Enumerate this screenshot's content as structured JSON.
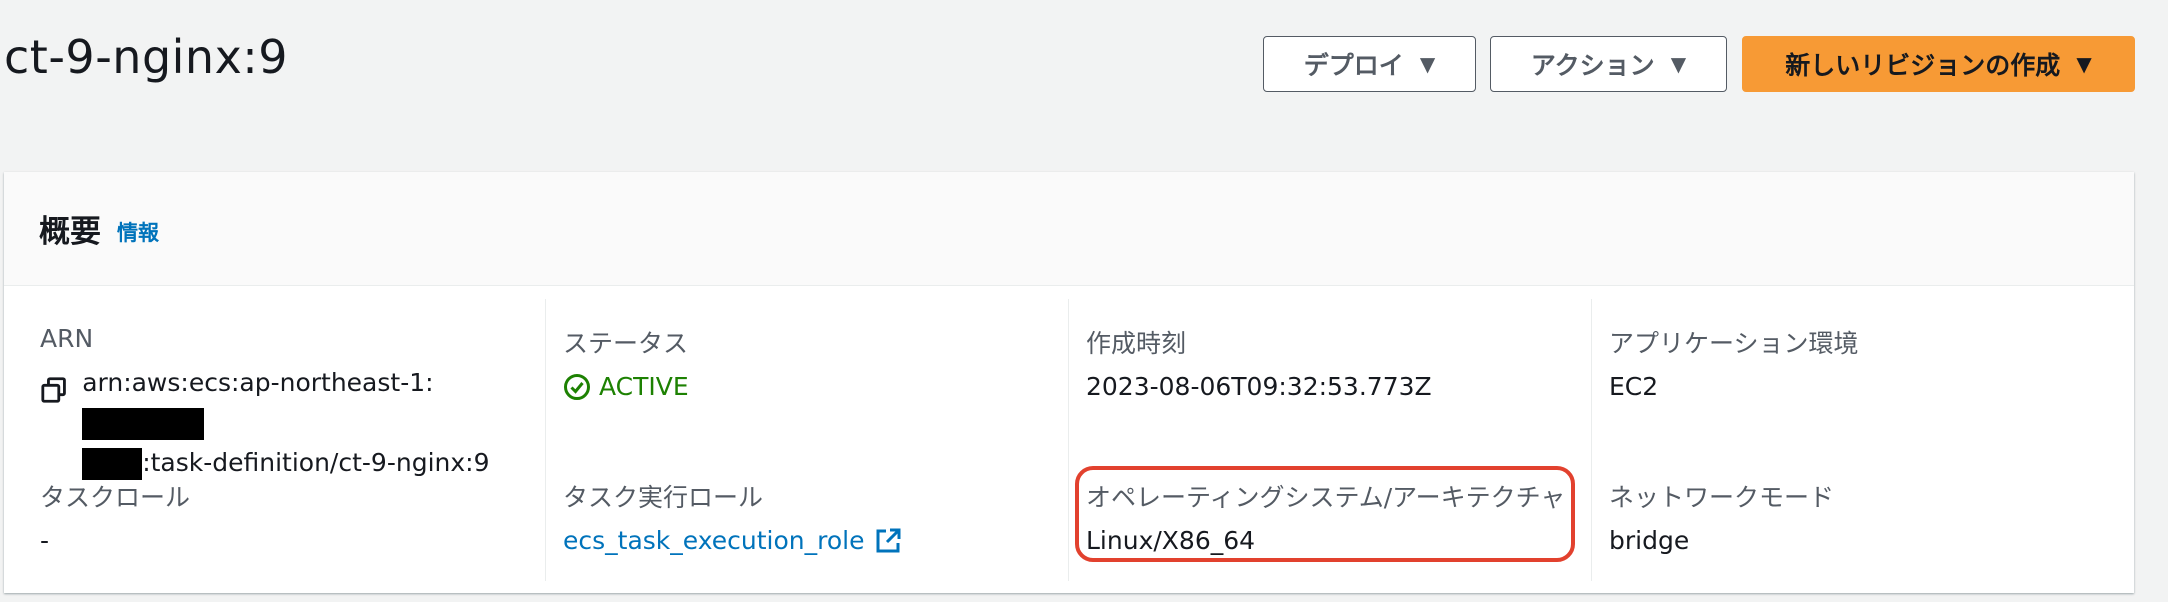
{
  "page": {
    "title": "ct-9-nginx:9"
  },
  "header_actions": {
    "deploy_label": "デプロイ",
    "actions_label": "アクション",
    "create_revision_label": "新しいリビジョンの作成",
    "caret": "▼"
  },
  "overview": {
    "title": "概要",
    "info_link": "情報",
    "arn": {
      "label": "ARN",
      "value_part1": "arn:aws:ecs:ap-northeast-1:",
      "value_part2": ":task-definition/ct-9-nginx:9"
    },
    "status": {
      "label": "ステータス",
      "value": "ACTIVE"
    },
    "created_at": {
      "label": "作成時刻",
      "value": "2023-08-06T09:32:53.773Z"
    },
    "app_environment": {
      "label": "アプリケーション環境",
      "value": "EC2"
    },
    "task_role": {
      "label": "タスクロール",
      "value": "-"
    },
    "task_execution_role": {
      "label": "タスク実行ロール",
      "value": "ecs_task_execution_role"
    },
    "os_architecture": {
      "label": "オペレーティングシステム/アーキテクチャ",
      "value": "Linux/X86_64"
    },
    "network_mode": {
      "label": "ネットワークモード",
      "value": "bridge"
    }
  },
  "colors": {
    "primary_button": "#f79a35",
    "link": "#0073bb",
    "status_active": "#1d8102",
    "highlight": "#e2412e"
  },
  "icons": [
    "copy-icon",
    "check-circle-icon",
    "external-link-icon",
    "caret-down-icon"
  ]
}
